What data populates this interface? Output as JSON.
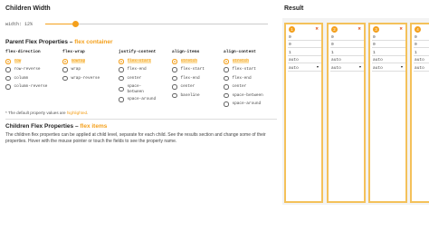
{
  "children_width": {
    "title": "Children Width",
    "label": "width: 12%",
    "value_percent": 12
  },
  "result": {
    "title": "Result"
  },
  "parent": {
    "title_main": "Parent Flex Properties",
    "title_sep": " – ",
    "title_accent": "flex container",
    "columns": [
      {
        "head": "flex-direction",
        "options": [
          "row",
          "row-reverse",
          "column",
          "column-reverse"
        ],
        "selected": 0
      },
      {
        "head": "flex-wrap",
        "options": [
          "nowrap",
          "wrap",
          "wrap-reverse"
        ],
        "selected": 0
      },
      {
        "head": "justify-content",
        "options": [
          "flex-start",
          "flex-end",
          "center",
          "space-\nbetween",
          "space-around"
        ],
        "selected": 0
      },
      {
        "head": "align-items",
        "options": [
          "stretch",
          "flex-start",
          "flex-end",
          "center",
          "baseline"
        ],
        "selected": 0
      },
      {
        "head": "align-content",
        "options": [
          "stretch",
          "flex-start",
          "flex-end",
          "center",
          "space-between",
          "space-around"
        ],
        "selected": 0
      }
    ],
    "note_prefix": "* The default property values are ",
    "note_hl": "highlighted",
    "note_suffix": "."
  },
  "children": {
    "title_main": "Children Flex Properties",
    "title_sep": " – ",
    "title_accent": "flex items",
    "description": "The children flex properties can be applied at child level, separate for each child. See the results section and change some of their properties. Hover with the mouse pointer or touch the fields to see the property name."
  },
  "items": [
    {
      "number": "1",
      "close": "✖",
      "order": "0",
      "grow": "0",
      "shrink": "1",
      "basis": "auto",
      "align_self": "auto"
    },
    {
      "number": "2",
      "close": "✖",
      "order": "0",
      "grow": "0",
      "shrink": "1",
      "basis": "auto",
      "align_self": "auto"
    },
    {
      "number": "3",
      "close": "✖",
      "order": "0",
      "grow": "0",
      "shrink": "1",
      "basis": "auto",
      "align_self": "auto"
    },
    {
      "number": "4",
      "close": "✖",
      "order": "0",
      "grow": "0",
      "shrink": "1",
      "basis": "auto",
      "align_self": "auto"
    }
  ],
  "colors": {
    "accent": "#f4a01c",
    "item_border": "#f4c15a"
  }
}
